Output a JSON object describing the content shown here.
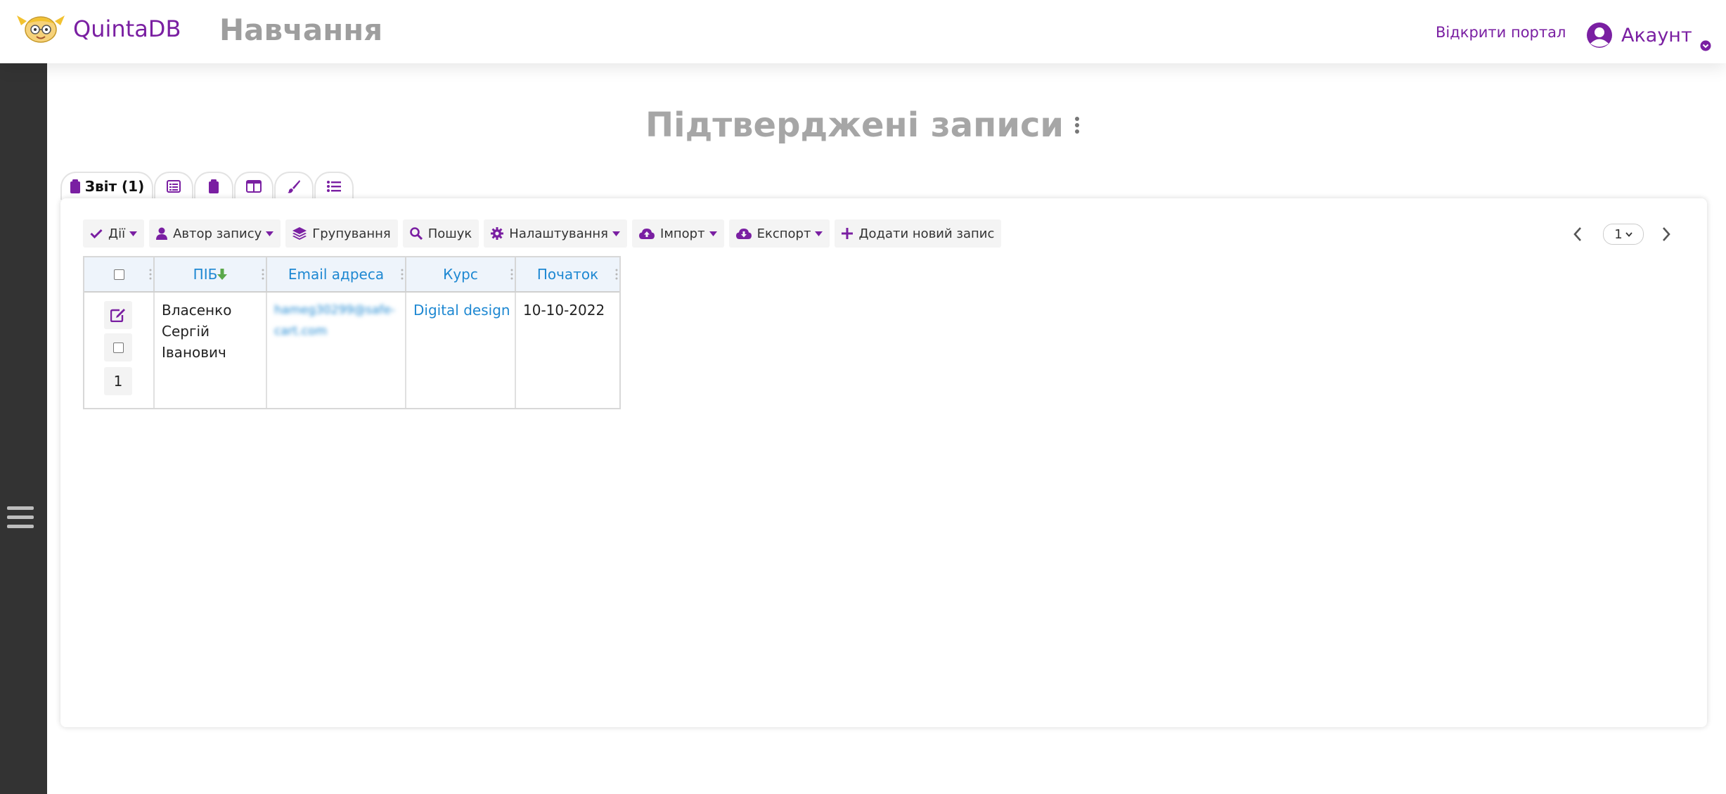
{
  "header": {
    "brand": "QuintaDB",
    "app_title": "Навчання",
    "portal_link": "Відкрити портал",
    "account_label": "Акаунт"
  },
  "page": {
    "title": "Підтверджені записи"
  },
  "tabs": [
    {
      "label": "Звіт (1)",
      "icon": "clipboard-icon",
      "active": true
    },
    {
      "label": "",
      "icon": "form-list-icon"
    },
    {
      "label": "",
      "icon": "clipboard-icon"
    },
    {
      "label": "",
      "icon": "columns-icon"
    },
    {
      "label": "",
      "icon": "brush-icon"
    },
    {
      "label": "",
      "icon": "list-icon"
    }
  ],
  "toolbar": {
    "actions": "Дії",
    "author": "Автор запису",
    "grouping": "Групування",
    "search": "Пошук",
    "settings": "Налаштування",
    "import": "Імпорт",
    "export": "Експорт",
    "add_new": "Додати новий запис"
  },
  "pagination": {
    "current_page": "1"
  },
  "table": {
    "columns": [
      "ПІБ",
      "Email адреса",
      "Курс",
      "Початок"
    ],
    "sorted_column": "ПІБ",
    "rows": [
      {
        "number": "1",
        "name": "Власенко Сергій Іванович",
        "email": "hameg30299@safe-cart.com",
        "course": "Digital design",
        "start": "10-10-2022"
      }
    ]
  },
  "colors": {
    "accent": "#7a1fa2",
    "link": "#1e88d2",
    "sidebar": "#333333",
    "title_gray": "#a6a6a6"
  }
}
